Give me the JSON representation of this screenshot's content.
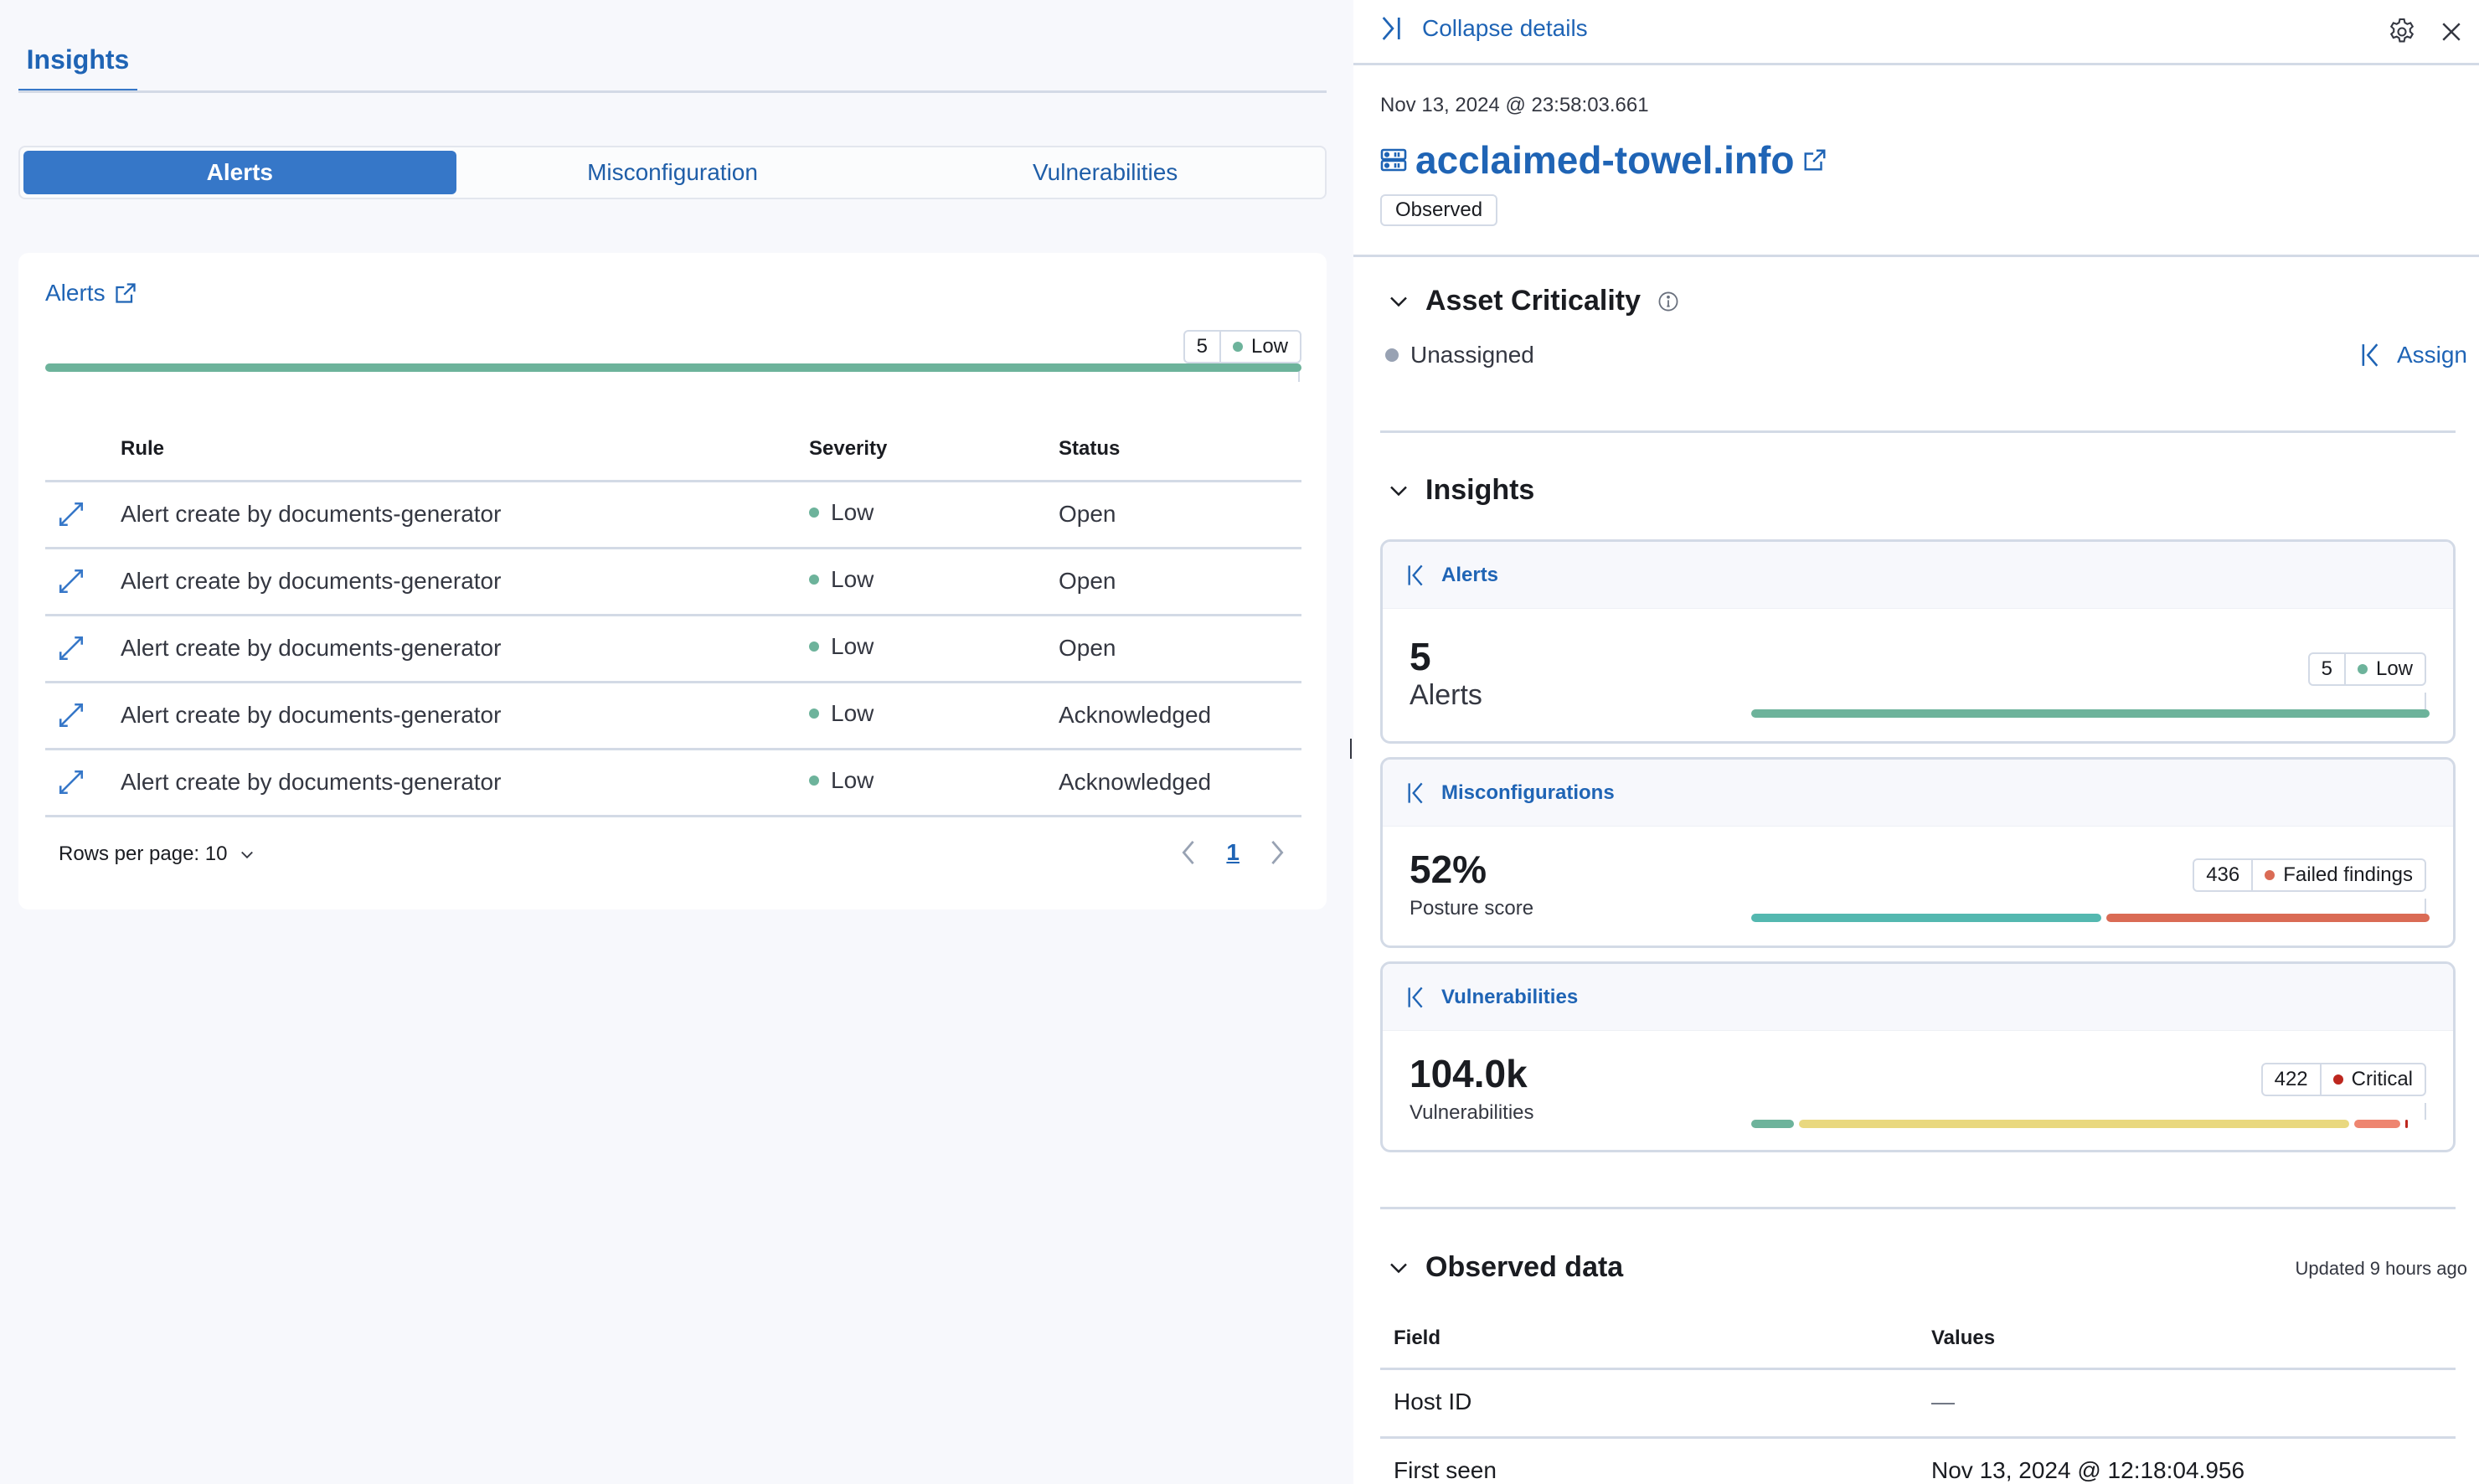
{
  "left": {
    "tab": "Insights",
    "segments": [
      "Alerts",
      "Misconfiguration",
      "Vulnerabilities"
    ],
    "active_segment": "Alerts",
    "card": {
      "title": "Alerts",
      "summary_pill": {
        "count": "5",
        "label": "Low",
        "color": "#6dccb1"
      },
      "distribution": [
        {
          "label": "Low",
          "fraction": 1.0,
          "color": "#6db39b"
        }
      ],
      "columns": [
        "Rule",
        "Severity",
        "Status"
      ],
      "rows": [
        {
          "rule": "Alert create by documents-generator",
          "severity": "Low",
          "status": "Open"
        },
        {
          "rule": "Alert create by documents-generator",
          "severity": "Low",
          "status": "Open"
        },
        {
          "rule": "Alert create by documents-generator",
          "severity": "Low",
          "status": "Open"
        },
        {
          "rule": "Alert create by documents-generator",
          "severity": "Low",
          "status": "Acknowledged"
        },
        {
          "rule": "Alert create by documents-generator",
          "severity": "Low",
          "status": "Acknowledged"
        }
      ],
      "rows_per_page": "Rows per page: 10",
      "current_page": "1"
    }
  },
  "right": {
    "collapse_label": "Collapse details",
    "timestamp": "Nov 13, 2024 @ 23:58:03.661",
    "host_name": "acclaimed-towel.info",
    "badge": "Observed",
    "asset_criticality": {
      "title": "Asset Criticality",
      "value": "Unassigned",
      "assign_label": "Assign"
    },
    "insights": {
      "title": "Insights",
      "alerts": {
        "header": "Alerts",
        "value": "5",
        "label": "Alerts",
        "pill": {
          "count": "5",
          "label": "Low"
        },
        "distribution": [
          {
            "label": "Low",
            "fraction": 1.0,
            "color": "#6db39b"
          }
        ]
      },
      "misconfigurations": {
        "header": "Misconfigurations",
        "value": "52%",
        "label": "Posture score",
        "pill": {
          "count": "436",
          "label": "Failed findings"
        },
        "distribution": [
          {
            "label": "Passed",
            "fraction": 0.52,
            "color": "#54b8b0"
          },
          {
            "label": "Failed",
            "fraction": 0.48,
            "color": "#da6b55"
          }
        ]
      },
      "vulnerabilities": {
        "header": "Vulnerabilities",
        "value": "104.0k",
        "label": "Vulnerabilities",
        "pill": {
          "count": "422",
          "label": "Critical"
        },
        "distribution": [
          {
            "label": "Low",
            "fraction": 0.065,
            "color": "#6db39b"
          },
          {
            "label": "Medium",
            "fraction": 0.83,
            "color": "#e9d87f"
          },
          {
            "label": "High",
            "fraction": 0.07,
            "color": "#ee8570"
          },
          {
            "label": "Critical",
            "fraction": 0.004,
            "color": "#bd271e"
          }
        ]
      }
    },
    "observed_data": {
      "title": "Observed data",
      "updated": "Updated 9 hours ago",
      "columns": [
        "Field",
        "Values"
      ],
      "rows": [
        {
          "field": "Host ID",
          "value": "—"
        },
        {
          "field": "First seen",
          "value": "Nov 13, 2024 @ 12:18:04.956"
        }
      ]
    }
  },
  "colors": {
    "accent": "#3677c8",
    "link": "#1f64b5",
    "low": "#6db39b",
    "failed": "#da6b55",
    "critical": "#bd271e",
    "unassigned": "#98a2b3"
  }
}
